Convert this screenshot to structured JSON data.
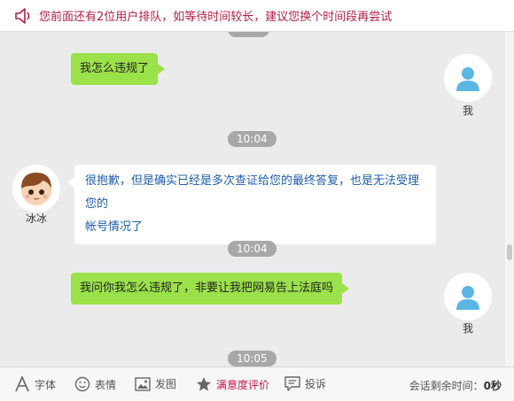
{
  "notice": {
    "text": "您前面还有2位用户排队，如等待时间较长，建议您换个时间段再尝试"
  },
  "messages": {
    "m1": {
      "text": "我怎么违规了",
      "sender": "我"
    },
    "t1": "10:04",
    "m2": {
      "line1": "很抱歉，但是确实已经是多次查证给您的最终答复，也是无法受理您的",
      "line2": "帐号情况了",
      "sender": "冰冰"
    },
    "t2": "10:04",
    "m3": {
      "text": "我问你我怎么违规了，非要让我把网易告上法庭吗",
      "sender": "我"
    },
    "t3": "10:05"
  },
  "toolbar": {
    "font": "字体",
    "emoji": "表情",
    "image": "发图",
    "rating": "满意度评价",
    "complaint": "投诉",
    "session_label": "会话剩余时间：",
    "session_value": "0秒"
  },
  "colors": {
    "accent": "#b21d40",
    "bubble_self": "#9be14a",
    "bubble_agent_text": "#1c5dab",
    "time_pill": "#a8a8a8"
  },
  "icons": [
    "speaker-icon",
    "user-avatar-icon",
    "agent-avatar",
    "font-icon",
    "emoji-icon",
    "image-icon",
    "star-icon",
    "complaint-icon"
  ]
}
